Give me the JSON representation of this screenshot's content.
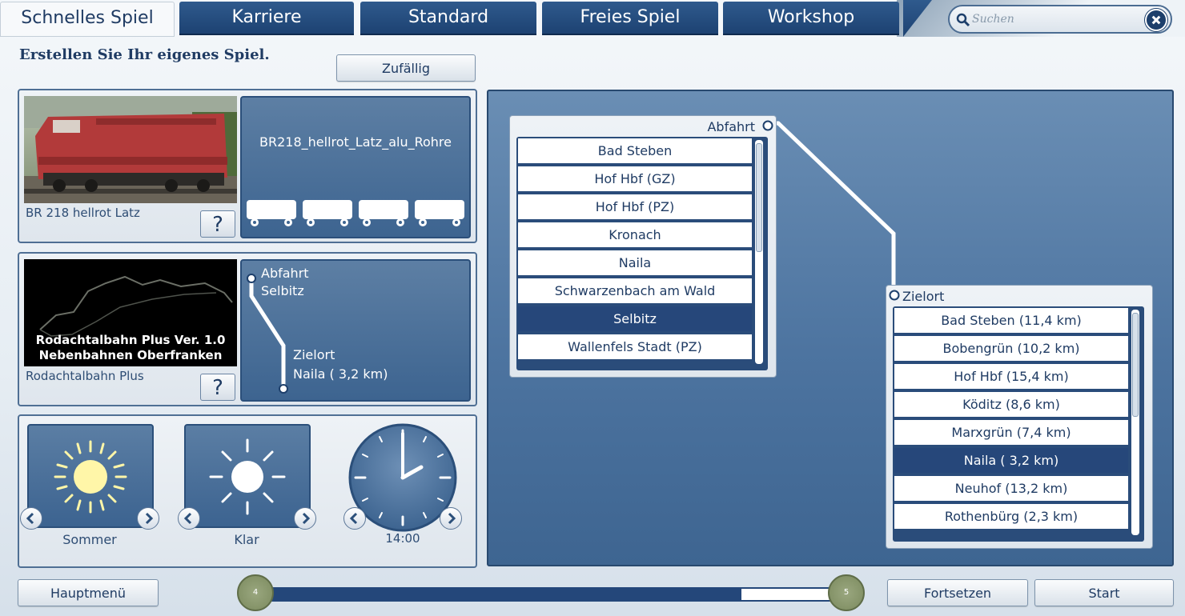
{
  "tabs": [
    {
      "label": "Schnelles Spiel",
      "active": true
    },
    {
      "label": "Karriere",
      "active": false
    },
    {
      "label": "Standard",
      "active": false
    },
    {
      "label": "Freies Spiel",
      "active": false
    },
    {
      "label": "Workshop",
      "active": false
    }
  ],
  "search": {
    "placeholder": "Suchen",
    "value": ""
  },
  "heading": "Erstellen Sie Ihr eigenes Spiel.",
  "random_button": "Zufällig",
  "locomotive": {
    "name": "BR 218 hellrot Latz",
    "consist_name": "BR218_hellrot_Latz_alu_Rohre",
    "help_label": "?"
  },
  "route": {
    "name": "Rodachtalbahn Plus",
    "thumb_line1": "Rodachtalbahn  Plus Ver. 1.0",
    "thumb_line2": "Nebenbahnen Oberfranken",
    "departure_label": "Abfahrt",
    "departure_value": "Selbitz",
    "destination_label": "Zielort",
    "destination_value": "Naila ( 3,2 km)",
    "help_label": "?"
  },
  "environment": {
    "season": "Sommer",
    "weather": "Klar",
    "time": "14:00"
  },
  "departure_list": {
    "header": "Abfahrt",
    "items": [
      "Bad Steben",
      "Hof Hbf (GZ)",
      "Hof Hbf (PZ)",
      "Kronach",
      "Naila",
      "Schwarzenbach am Wald",
      "Selbitz",
      "Wallenfels Stadt (PZ)"
    ],
    "selected": 6
  },
  "destination_list": {
    "header": "Zielort",
    "items": [
      "Bad Steben (11,4 km)",
      "Bobengrün (10,2 km)",
      "Hof Hbf  (15,4 km)",
      "Köditz (8,6 km)",
      "Marxgrün (7,4 km)",
      "Naila ( 3,2 km)",
      "Neuhof (13,2 km)",
      "Rothenbürg (2,3 km)"
    ],
    "selected": 5
  },
  "footer": {
    "main_menu": "Hauptmenü",
    "continue": "Fortsetzen",
    "start": "Start",
    "step_current": "4",
    "step_next": "5"
  },
  "colors": {
    "accent": "#26477a",
    "panel_blue": "#4d74a0",
    "route_line": "#ffffff",
    "step_dot": "#8a9770"
  }
}
